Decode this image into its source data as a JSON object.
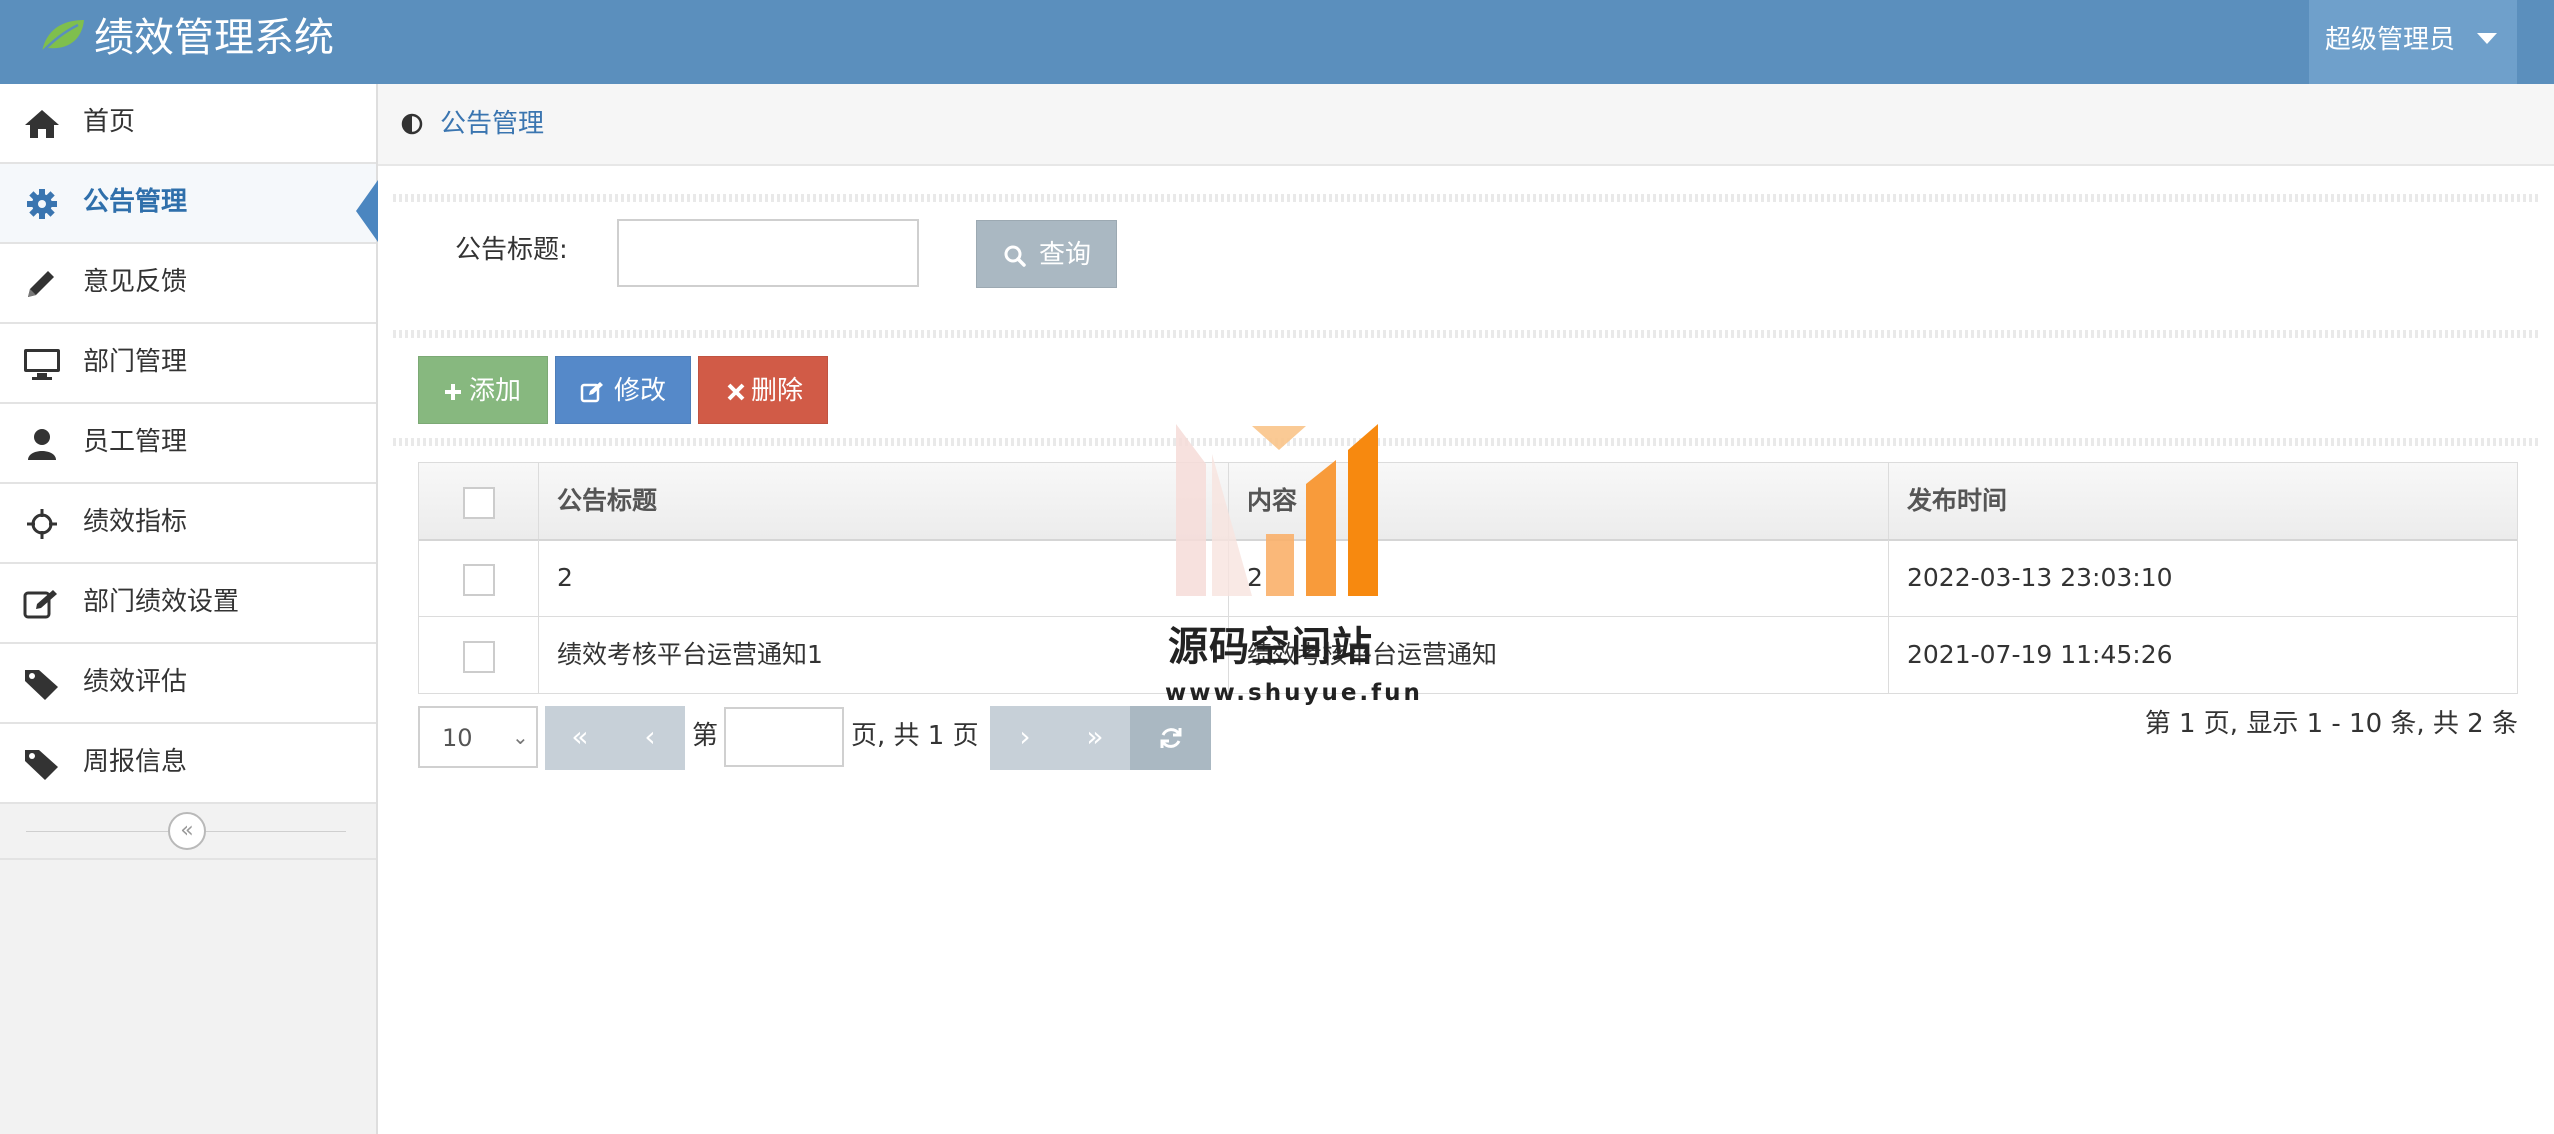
{
  "header": {
    "app_title": "绩效管理系统",
    "user_name": "超级管理员"
  },
  "sidebar": {
    "items": [
      {
        "label": "首页",
        "icon": "home-icon"
      },
      {
        "label": "公告管理",
        "icon": "gear-icon",
        "active": true
      },
      {
        "label": "意见反馈",
        "icon": "pencil-icon"
      },
      {
        "label": "部门管理",
        "icon": "monitor-icon"
      },
      {
        "label": "员工管理",
        "icon": "user-icon"
      },
      {
        "label": "绩效指标",
        "icon": "crosshairs-icon"
      },
      {
        "label": "部门绩效设置",
        "icon": "edit-icon"
      },
      {
        "label": "绩效评估",
        "icon": "tag-icon"
      },
      {
        "label": "周报信息",
        "icon": "tag-icon"
      }
    ]
  },
  "breadcrumb": {
    "text": "公告管理"
  },
  "search": {
    "label": "公告标题:",
    "value": "",
    "button_label": "查询"
  },
  "toolbar": {
    "add_label": "添加",
    "edit_label": "修改",
    "delete_label": "删除"
  },
  "table": {
    "columns": [
      "公告标题",
      "内容",
      "发布时间"
    ],
    "rows": [
      {
        "title": "2",
        "content": "2",
        "time": "2022-03-13 23:03:10"
      },
      {
        "title": "绩效考核平台运营通知1",
        "content": "绩效考核平台运营通知",
        "time": "2021-07-19 11:45:26"
      }
    ]
  },
  "pager": {
    "page_size": "10",
    "first": "«",
    "prev": "‹",
    "next": "›",
    "last": "»",
    "page_prefix": "第",
    "page_suffix": "页, 共 1 页",
    "current_page": "",
    "summary": "第 1 页,  显示 1 - 10 条, 共 2 条"
  },
  "watermark": {
    "name": "源码空间站",
    "url": "www.shuyue.fun"
  },
  "colors": {
    "header_bg": "#5b8fbd",
    "accent": "#2f6fab",
    "add": "#87b87f",
    "edit": "#5589c9",
    "delete": "#d15b47",
    "query": "#aab8c2"
  }
}
